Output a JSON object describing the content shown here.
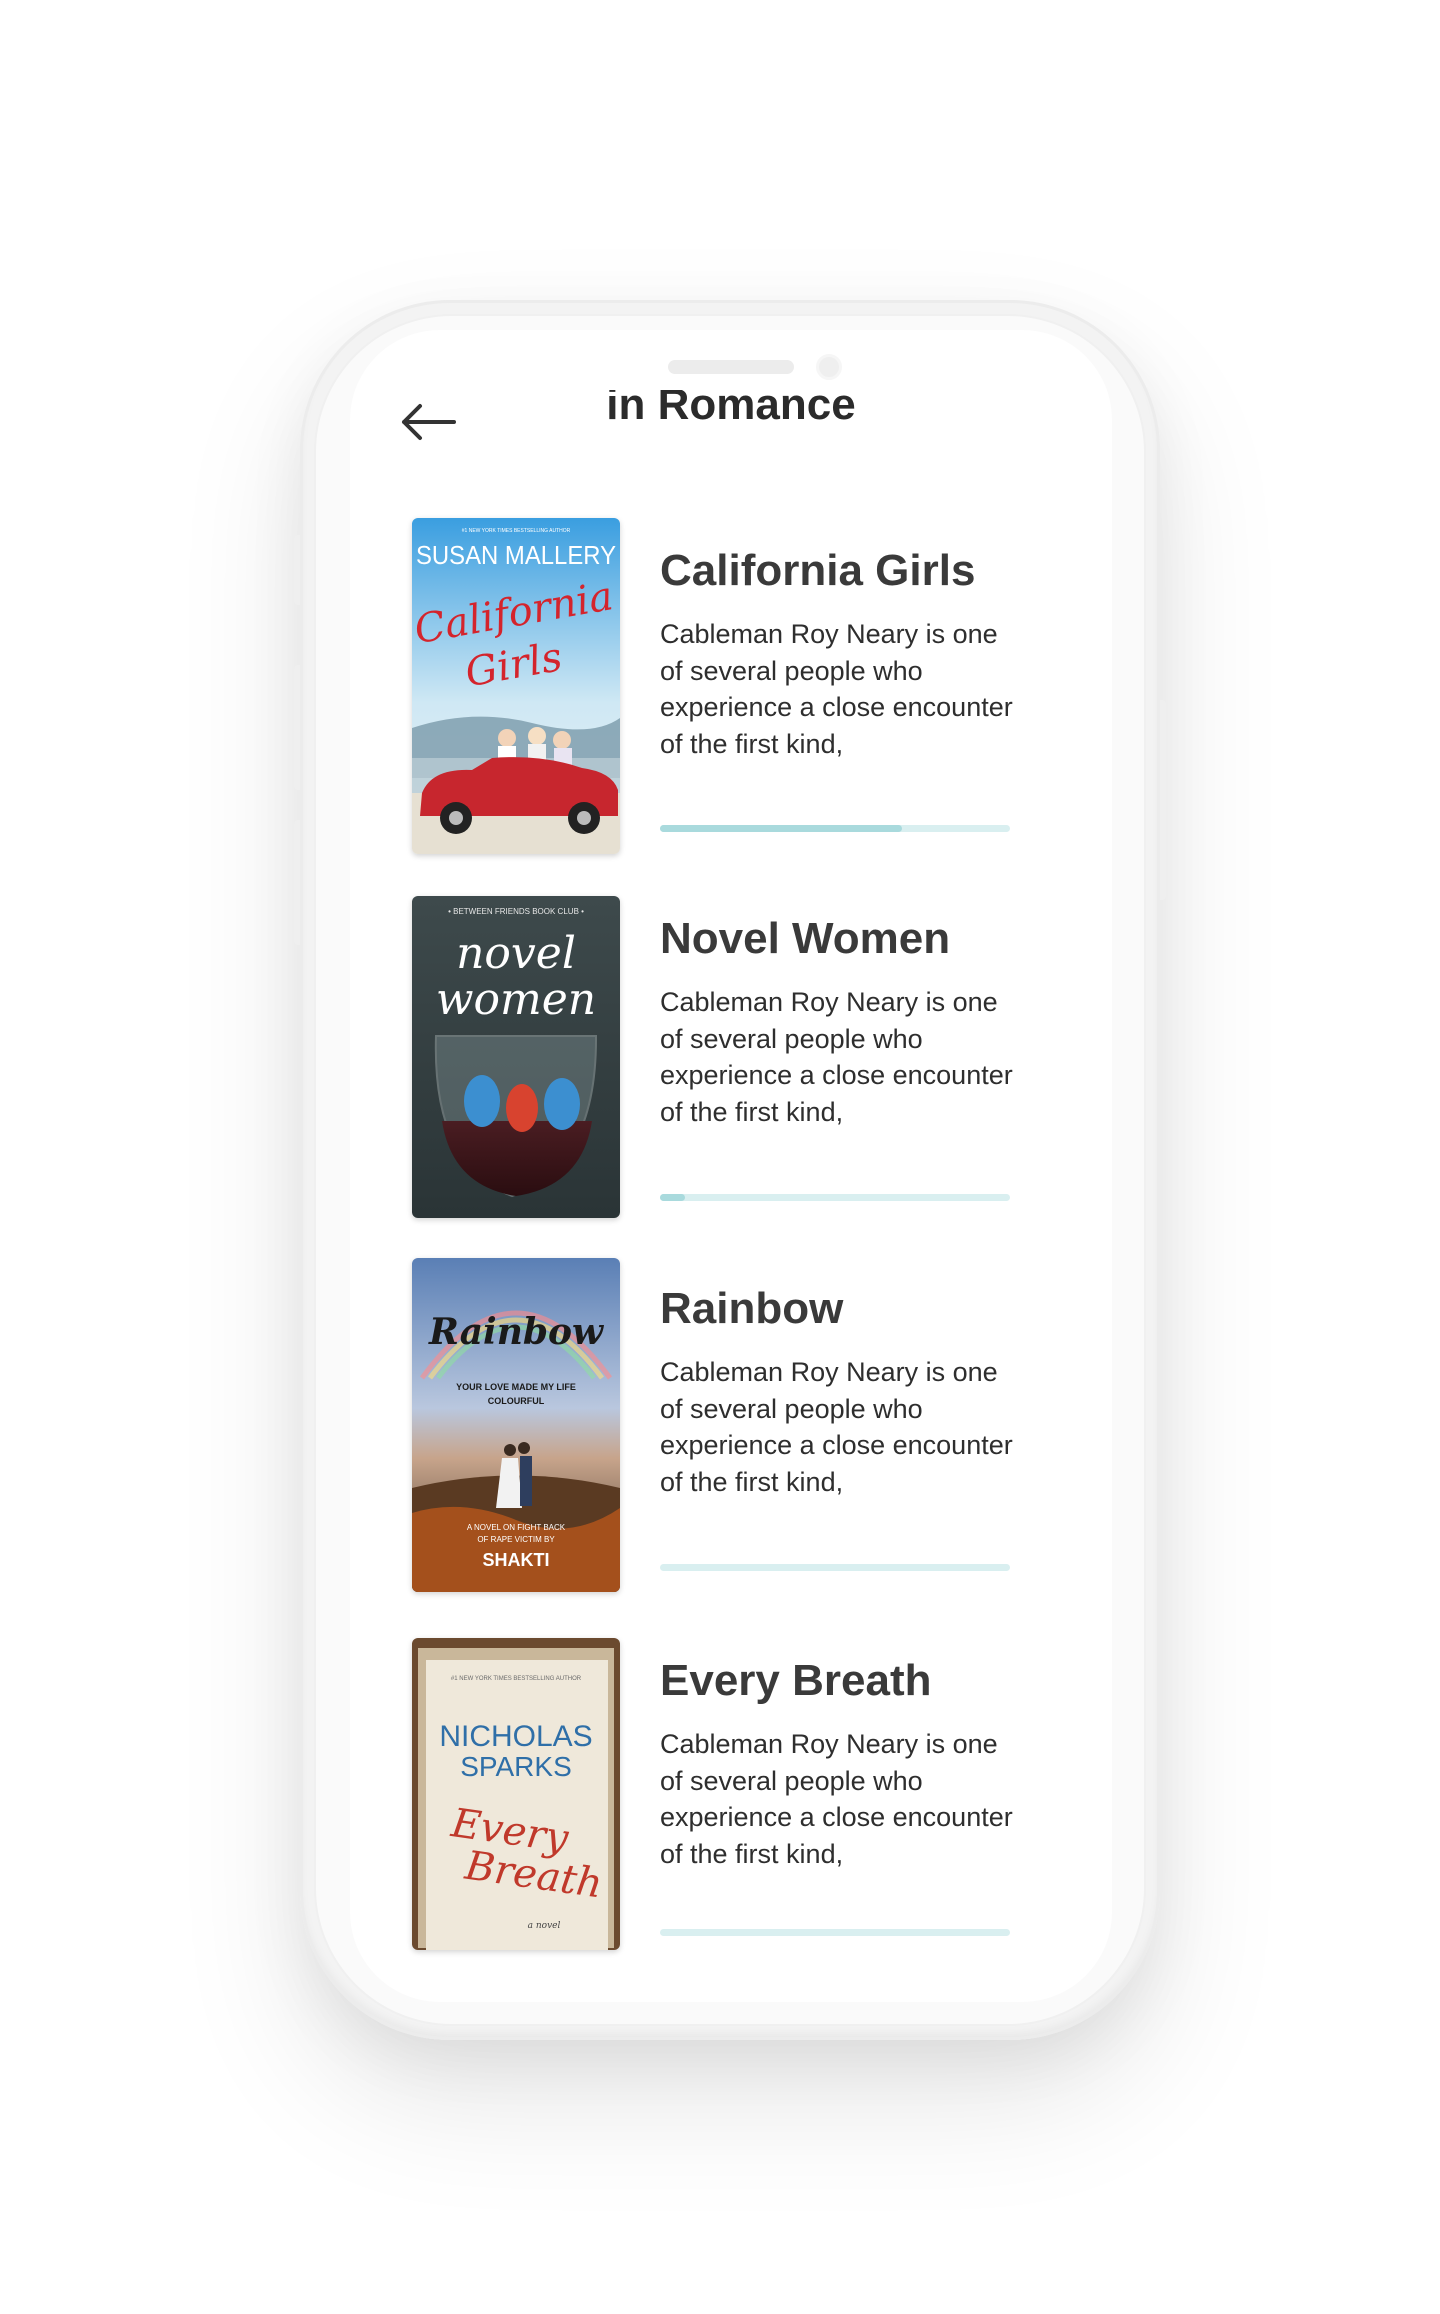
{
  "header": {
    "title": "in Romance",
    "back_icon": "arrow-left-icon"
  },
  "books": [
    {
      "title": "California Girls",
      "description": "Cableman Roy Neary is one of several people who experience a close encounter of the first kind,",
      "progress": 0.69,
      "cover": {
        "author": "SUSAN MALLERY",
        "title": "California Girls",
        "tagline": "#1 NEW YORK TIMES BESTSELLING AUTHOR"
      }
    },
    {
      "title": "Novel Women",
      "description": "Cableman Roy Neary is one of several people who experience a close encounter of the first kind,",
      "progress": 0.07,
      "cover": {
        "series": "• BETWEEN FRIENDS BOOK CLUB •",
        "title": "novel women"
      }
    },
    {
      "title": "Rainbow",
      "description": "Cableman Roy Neary is one of several people who experience a close encounter of the first kind,",
      "progress": 0.0,
      "cover": {
        "title": "Rainbow",
        "subtitle": "YOUR LOVE MADE MY LIFE COLOURFUL",
        "blurb": "A NOVEL ON FIGHT BACK OF RAPE VICTIM BY",
        "author": "SHAKTI"
      }
    },
    {
      "title": "Every Breath",
      "description": "Cableman Roy Neary is one of several people who experience a close encounter of the first kind,",
      "progress": 0.0,
      "cover": {
        "tagline": "#1 NEW YORK TIMES BESTSELLING AUTHOR",
        "author_line1": "NICHOLAS",
        "author_line2": "SPARKS",
        "title_line1": "Every",
        "title_line2": "Breath",
        "type": "a novel"
      }
    }
  ],
  "colors": {
    "progress_track": "#d9eff0",
    "progress_fill": "#a9dadd",
    "title_text": "#3a3a3a"
  }
}
